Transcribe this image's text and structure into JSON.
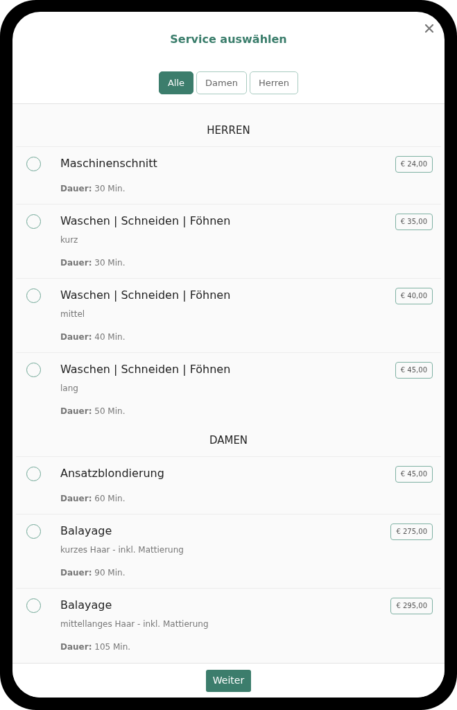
{
  "title": "Service auswählen",
  "filters": [
    {
      "label": "Alle",
      "selected": true
    },
    {
      "label": "Damen",
      "selected": false
    },
    {
      "label": "Herren",
      "selected": false
    }
  ],
  "sections": [
    {
      "heading": "HERREN",
      "services": [
        {
          "name": "Maschinenschnitt",
          "duration": "**Dauer:** 30 Min.",
          "price": "€ 24,00",
          "selected": false
        },
        {
          "name": "Waschen | Schneiden | Föhnen",
          "note": "kurz",
          "duration": "**Dauer:** 30 Min.",
          "price": "€ 35,00",
          "selected": false
        },
        {
          "name": "Waschen | Schneiden | Föhnen",
          "note": "mittel",
          "duration": "**Dauer:** 40 Min.",
          "price": "€ 40,00",
          "selected": false
        },
        {
          "name": "Waschen | Schneiden | Föhnen",
          "note": "lang",
          "duration": "**Dauer:** 50 Min.",
          "price": "€ 45,00",
          "selected": false
        }
      ]
    },
    {
      "heading": "DAMEN",
      "services": [
        {
          "name": "Ansatzblondierung",
          "duration": "**Dauer:** 60 Min.",
          "price": "€ 45,00",
          "selected": false
        },
        {
          "name": "Balayage",
          "note": "kurzes Haar - inkl. Mattierung",
          "duration": "**Dauer:** 90 Min.",
          "price": "€ 275,00",
          "selected": false
        },
        {
          "name": "Balayage",
          "note": "mittellanges Haar - inkl. Mattierung",
          "duration": "**Dauer:** 105 Min.",
          "price": "€ 295,00",
          "selected": false
        }
      ]
    }
  ],
  "next_button": "Weiter"
}
